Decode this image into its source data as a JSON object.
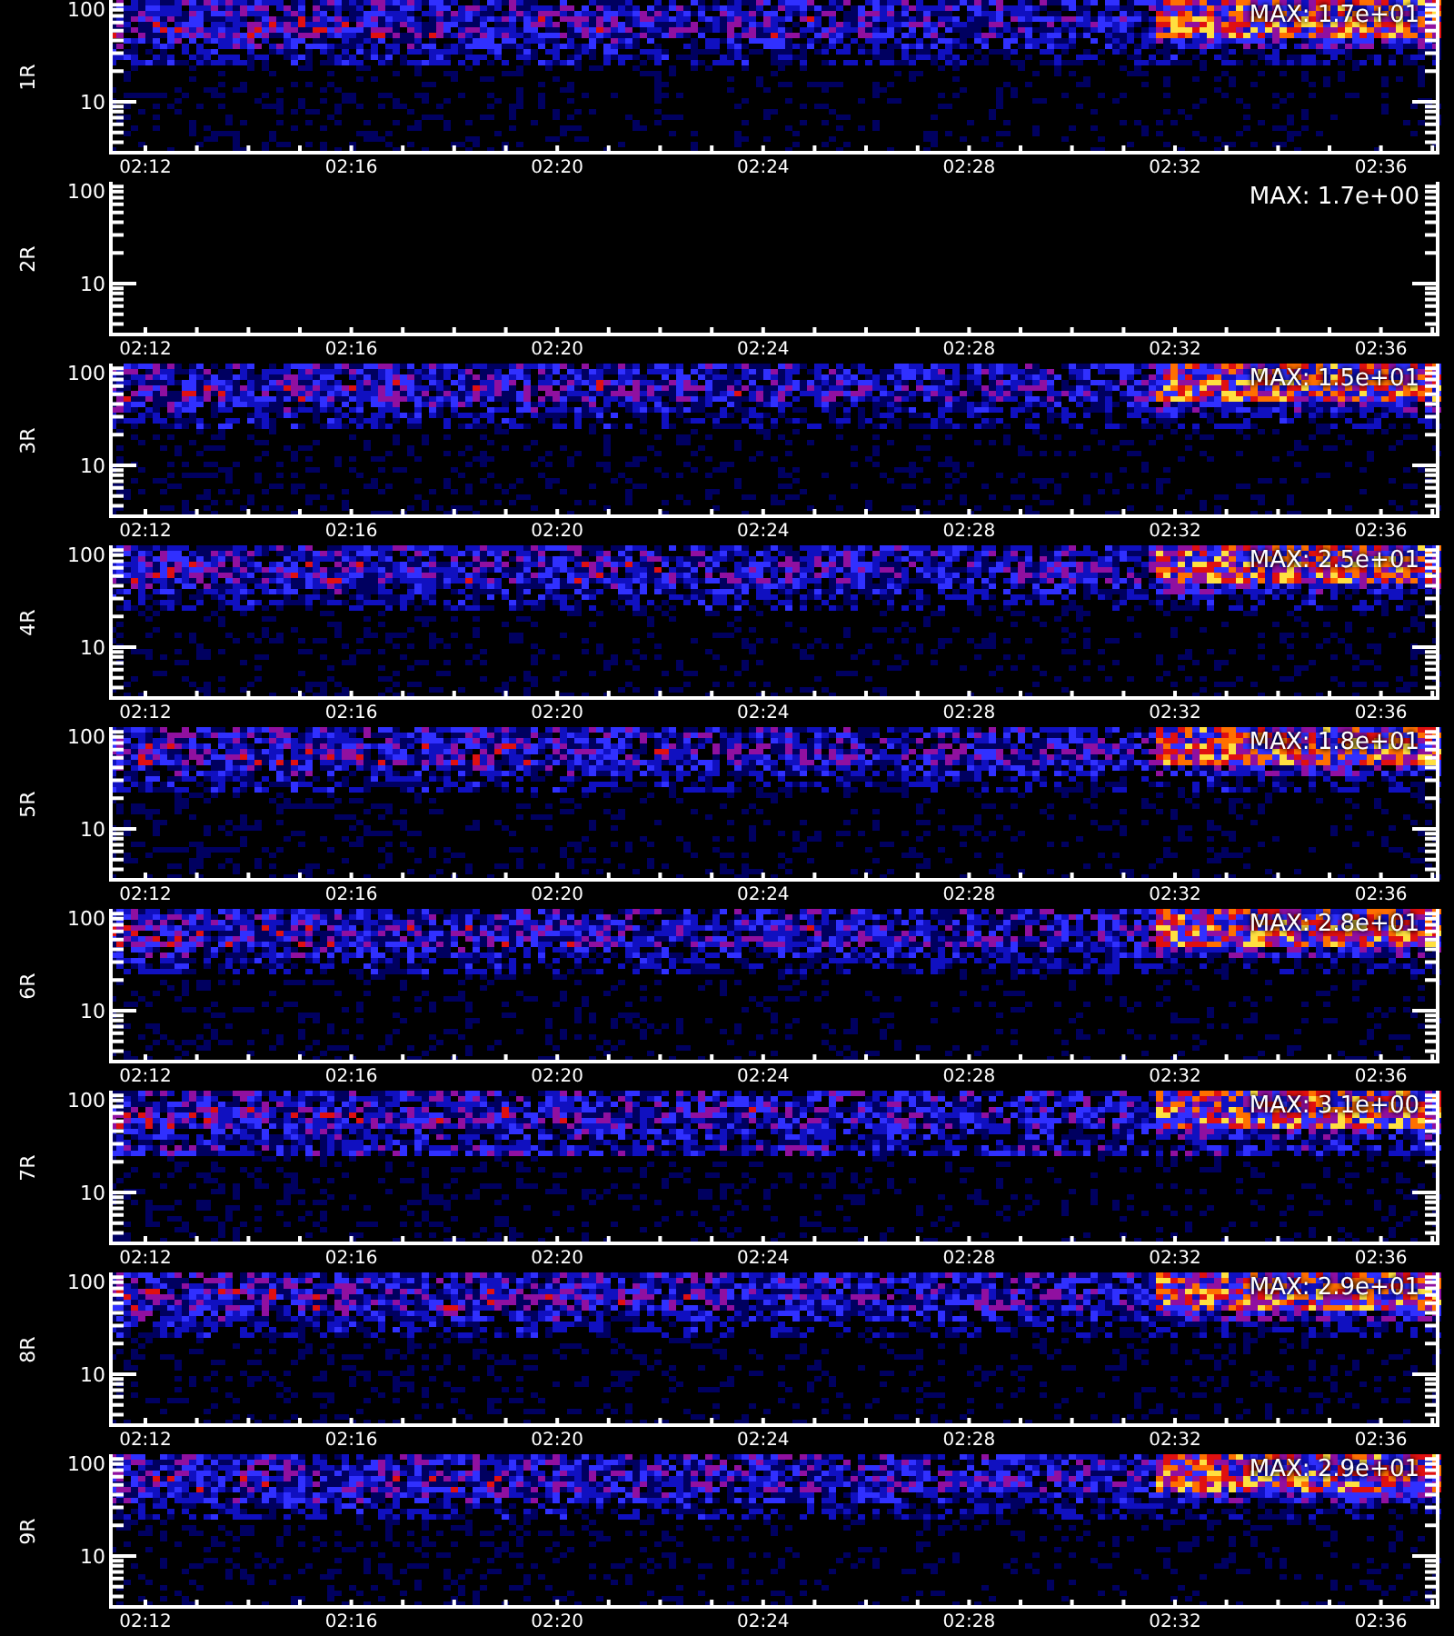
{
  "panels": [
    {
      "label": "1R",
      "kind": "spectrogram",
      "max": "MAX: 1.7e+01",
      "yticks": [
        "100",
        "10"
      ],
      "xticks": [
        "02:12",
        "02:16",
        "02:20",
        "02:24",
        "02:28",
        "02:32",
        "02:36"
      ]
    },
    {
      "label": "2R",
      "kind": "blank",
      "max": "MAX: 1.7e+00",
      "yticks": [
        "100",
        "10"
      ],
      "xticks": [
        "02:12",
        "02:16",
        "02:20",
        "02:24",
        "02:28",
        "02:32",
        "02:36"
      ]
    },
    {
      "label": "3R",
      "kind": "spectrogram",
      "max": "MAX: 1.5e+01",
      "yticks": [
        "100",
        "10"
      ],
      "xticks": [
        "02:12",
        "02:16",
        "02:20",
        "02:24",
        "02:28",
        "02:32",
        "02:36"
      ]
    },
    {
      "label": "4R",
      "kind": "spectrogram",
      "max": "MAX: 2.5e+01",
      "yticks": [
        "100",
        "10"
      ],
      "xticks": [
        "02:12",
        "02:16",
        "02:20",
        "02:24",
        "02:28",
        "02:32",
        "02:36"
      ]
    },
    {
      "label": "5R",
      "kind": "spectrogram",
      "max": "MAX: 1.8e+01",
      "yticks": [
        "100",
        "10"
      ],
      "xticks": [
        "02:12",
        "02:16",
        "02:20",
        "02:24",
        "02:28",
        "02:32",
        "02:36"
      ]
    },
    {
      "label": "6R",
      "kind": "spectrogram",
      "max": "MAX: 2.8e+01",
      "yticks": [
        "100",
        "10"
      ],
      "xticks": [
        "02:12",
        "02:16",
        "02:20",
        "02:24",
        "02:28",
        "02:32",
        "02:36"
      ]
    },
    {
      "label": "7R",
      "kind": "spectrogram",
      "max": "MAX: 3.1e+00",
      "yticks": [
        "100",
        "10"
      ],
      "xticks": [
        "02:12",
        "02:16",
        "02:20",
        "02:24",
        "02:28",
        "02:32",
        "02:36"
      ]
    },
    {
      "label": "8R",
      "kind": "spectrogram",
      "max": "MAX: 2.9e+01",
      "yticks": [
        "100",
        "10"
      ],
      "xticks": [
        "02:12",
        "02:16",
        "02:20",
        "02:24",
        "02:28",
        "02:32",
        "02:36"
      ]
    },
    {
      "label": "9R",
      "kind": "spectrogram",
      "max": "MAX: 2.9e+01",
      "yticks": [
        "100",
        "10"
      ],
      "xticks": [
        "02:12",
        "02:16",
        "02:20",
        "02:24",
        "02:28",
        "02:32",
        "02:36"
      ]
    }
  ]
}
